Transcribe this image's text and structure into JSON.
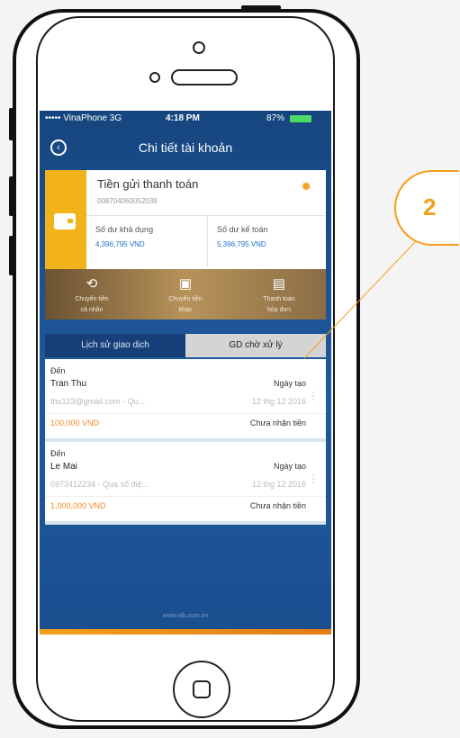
{
  "status_bar": {
    "carrier": "••••• VinaPhone 3G",
    "time": "4:18 PM",
    "battery": "87%"
  },
  "header": {
    "title": "Chi tiết tài khoản"
  },
  "account": {
    "name": "Tiền gửi thanh toán",
    "number": "008704060052039",
    "available_label": "Số dư khả dụng",
    "available_value": "4,396,795 VND",
    "ledger_label": "Số dư kế toán",
    "ledger_value": "5,396,795 VND"
  },
  "actions": [
    {
      "label1": "Chuyển tiền",
      "label2": "cá nhân"
    },
    {
      "label1": "Chuyển tiền",
      "label2": "khác"
    },
    {
      "label1": "Thanh toán",
      "label2": "hóa đơn"
    }
  ],
  "tabs": [
    {
      "label": "Lịch sử giao dịch"
    },
    {
      "label": "GD chờ xử lý"
    }
  ],
  "transactions": [
    {
      "direction": "Đến",
      "name": "Tran Thu",
      "detail": "thu123@gmail.com - Qu...",
      "amount": "100,000 VND",
      "date_label": "Ngày tạo",
      "date": "12 thg 12 2016",
      "status": "Chưa nhận tiền"
    },
    {
      "direction": "Đến",
      "name": "Le Mai",
      "detail": "0973412234 - Qua số điệ...",
      "amount": "1,000,000 VND",
      "date_label": "Ngày tạo",
      "date": "12 thg 12 2016",
      "status": "Chưa nhận tiền"
    }
  ],
  "footer": {
    "url": "www.vib.com.vn"
  },
  "callout": {
    "number": "2"
  },
  "colors": {
    "accent": "#f2a01a",
    "screen_bg": "#1a4d8c"
  }
}
